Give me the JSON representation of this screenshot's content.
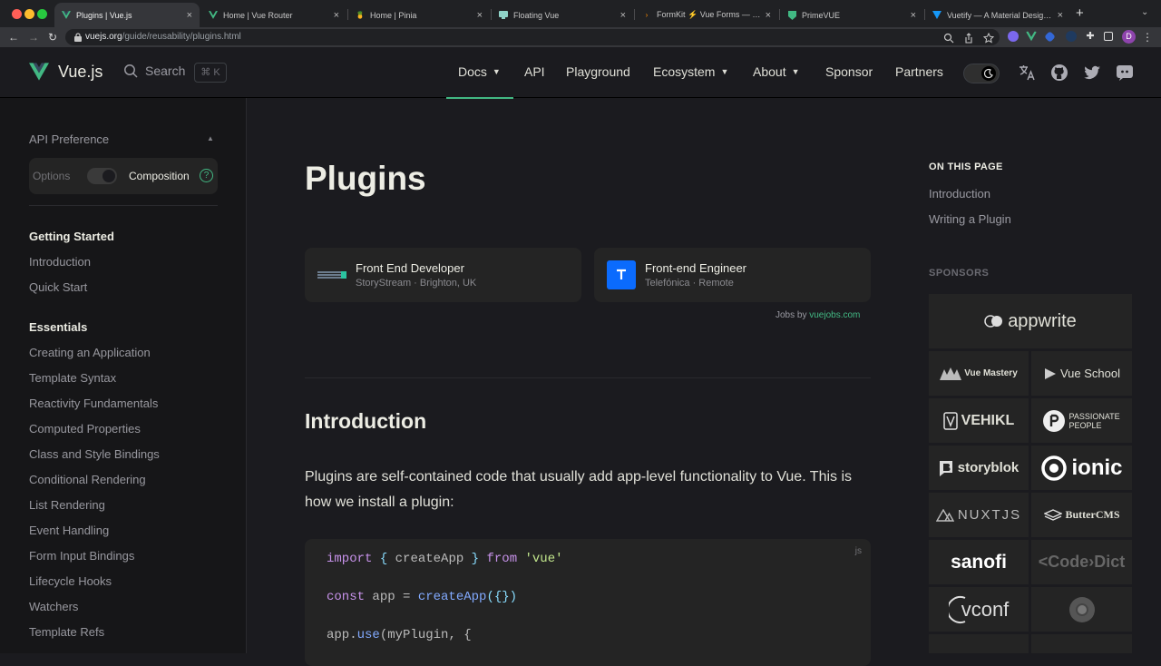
{
  "browser": {
    "tabs": [
      {
        "label": "Plugins | Vue.js",
        "active": true
      },
      {
        "label": "Home | Vue Router",
        "active": false
      },
      {
        "label": "Home | Pinia",
        "active": false
      },
      {
        "label": "Floating Vue",
        "active": false
      },
      {
        "label": "FormKit ⚡ Vue Forms — Supe",
        "active": false
      },
      {
        "label": "PrimeVUE",
        "active": false
      },
      {
        "label": "Vuetify — A Material Design Fr",
        "active": false
      }
    ],
    "url_domain": "vuejs.org",
    "url_path": "/guide/reusability/plugins.html",
    "profile_initial": "D"
  },
  "nav": {
    "brand": "Vue.js",
    "search_label": "Search",
    "search_kbd": "⌘ K",
    "items": [
      "Docs",
      "API",
      "Playground",
      "Ecosystem",
      "About",
      "Sponsor",
      "Partners"
    ]
  },
  "sidebar": {
    "api_pref_label": "API Preference",
    "options_label": "Options",
    "composition_label": "Composition",
    "help": "?",
    "sections": [
      {
        "title": "Getting Started",
        "links": [
          "Introduction",
          "Quick Start"
        ]
      },
      {
        "title": "Essentials",
        "links": [
          "Creating an Application",
          "Template Syntax",
          "Reactivity Fundamentals",
          "Computed Properties",
          "Class and Style Bindings",
          "Conditional Rendering",
          "List Rendering",
          "Event Handling",
          "Form Input Bindings",
          "Lifecycle Hooks",
          "Watchers",
          "Template Refs"
        ]
      }
    ]
  },
  "main": {
    "title": "Plugins",
    "jobs": [
      {
        "title": "Front End Developer",
        "subtitle": "StoryStream · Brighton, UK"
      },
      {
        "title": "Front-end Engineer",
        "subtitle": "Telefónica · Remote"
      }
    ],
    "jobs_by": "Jobs by",
    "jobs_link": "vuejobs.com",
    "intro_heading": "Introduction",
    "intro_text": "Plugins are self-contained code that usually add app-level functionality to Vue. This is how we install a plugin:",
    "code_lang": "js",
    "code": {
      "l1_import": "import",
      "l1_brace_open": " { ",
      "l1_name": "createApp",
      "l1_brace_close": " } ",
      "l1_from": "from",
      "l1_str": " 'vue'",
      "l2_const": "const",
      "l2_rest": " app = ",
      "l2_fn": "createApp",
      "l2_args": "({})",
      "l3_app": "app.",
      "l3_fn": "use",
      "l3_rest": "(myPlugin, {"
    }
  },
  "aside": {
    "on_this_page": "ON THIS PAGE",
    "links": [
      "Introduction",
      "Writing a Plugin"
    ],
    "sponsors_heading": "SPONSORS",
    "sponsors": [
      "appwrite",
      "Vue Mastery",
      "Vue School",
      "VEHIKL",
      "PASSIONATE PEOPLE",
      "storyblok",
      "ionic",
      "NUXTJS",
      "ButterCMS",
      "sanofi",
      "<Code›Dict",
      "vconf"
    ]
  },
  "colors": {
    "accent": "#42b883",
    "bg": "#1b1b1f",
    "sidebar_bg": "#161618",
    "card_bg": "#242424"
  }
}
